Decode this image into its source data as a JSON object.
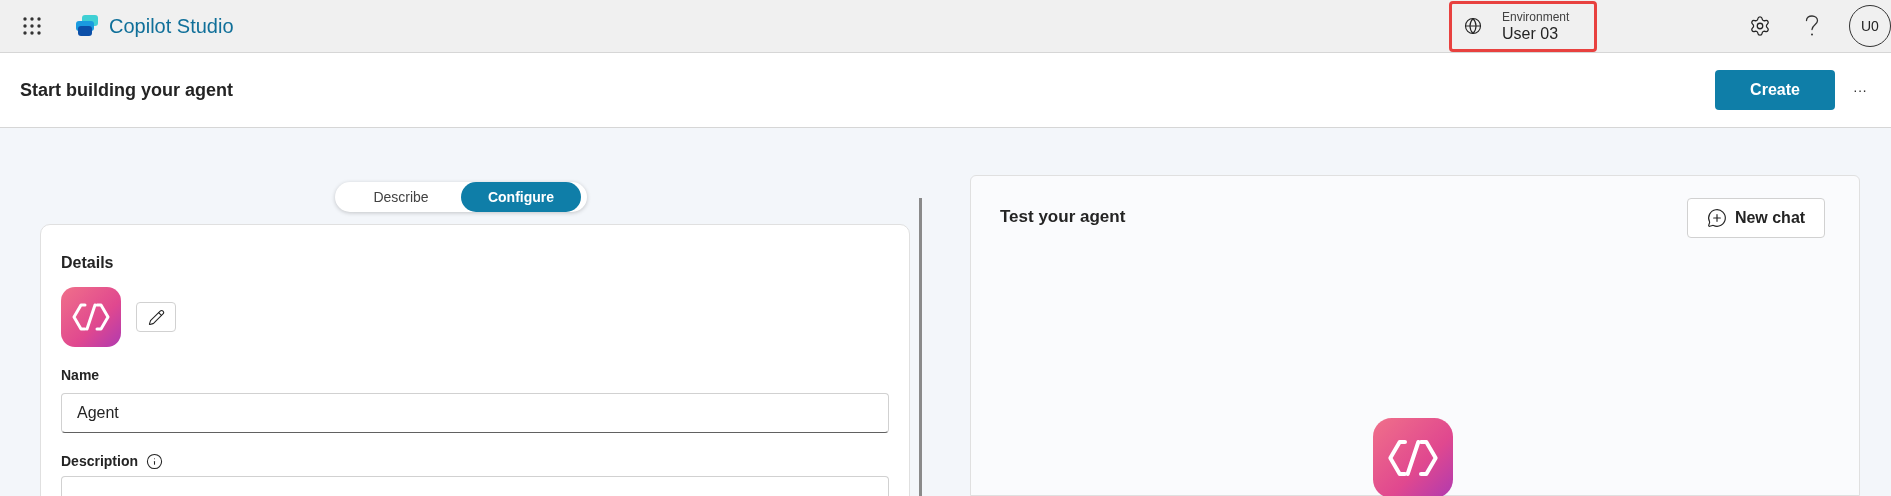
{
  "app_bar": {
    "title": "Copilot Studio",
    "environment": {
      "label": "Environment",
      "value": "User 03",
      "highlighted": true
    },
    "avatar": "U0"
  },
  "page_header": {
    "title": "Start building your agent",
    "create_button": "Create",
    "more_button": "···"
  },
  "mode_tabs": [
    {
      "label": "Describe",
      "selected": false
    },
    {
      "label": "Configure",
      "selected": true
    }
  ],
  "details": {
    "title": "Details",
    "name_label": "Name",
    "name_value": "Agent",
    "description_label": "Description"
  },
  "test_panel": {
    "title": "Test your agent",
    "new_chat_button": "New chat"
  }
}
